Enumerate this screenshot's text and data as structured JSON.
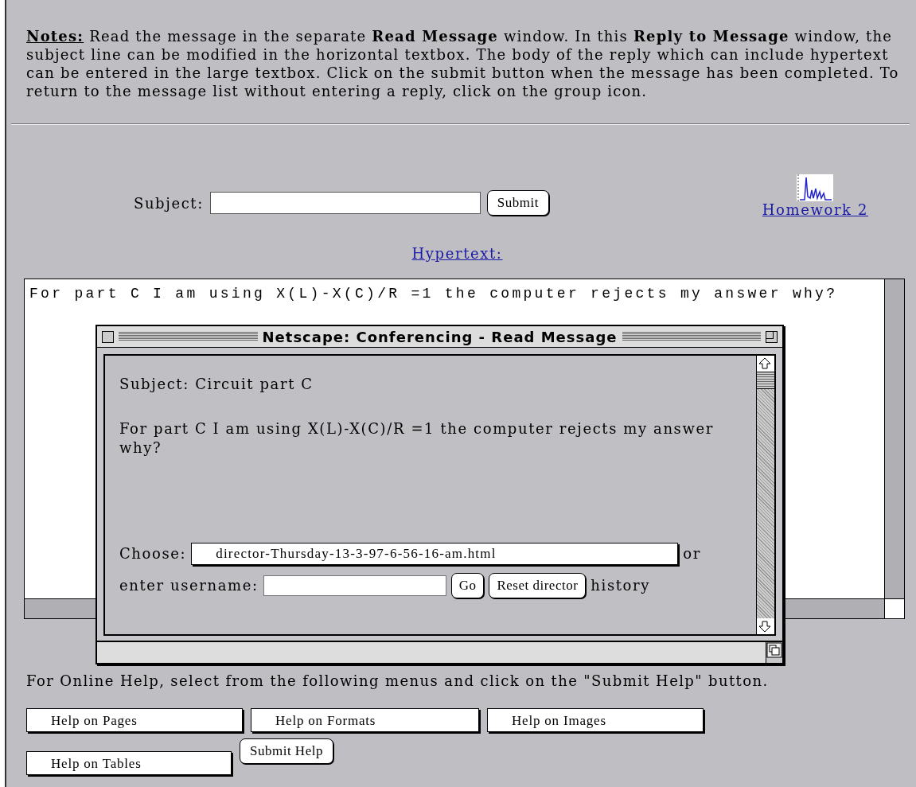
{
  "notes": {
    "label": "Notes:",
    "text": "Read the message in the separate **Read Message** window. In this **Reply to Message** window, the subject line can be modified in the horizontal textbox. The body of the reply which can include hypertext can be entered in the large textbox. Click on the submit button when the message has been completed. To return to the message list without entering a reply, click on the group icon."
  },
  "reply": {
    "subject_label": "Subject:",
    "submit": "Submit",
    "group_link": "Homework 2",
    "hypertext_link": "Hypertext:",
    "body": "For part C I am using X(L)-X(C)/R =1 the computer rejects my answer why?"
  },
  "read_window": {
    "title": "Netscape: Conferencing - Read Message",
    "subject": "Subject: Circuit part C",
    "message": "For part C I am using X(L)-X(C)/R =1 the computer rejects my answer why?",
    "choose_label": "Choose:",
    "choose_value": "director-Thursday-13-3-97-6-56-16-am.html",
    "or": "or",
    "username_label": "enter username:",
    "go": "Go",
    "reset": "Reset director",
    "history": "history"
  },
  "help": {
    "text": "For Online Help, select from the following menus and click on the \"Submit Help\" button.",
    "menus": [
      "Help on Pages",
      "Help on Formats",
      "Help on Images",
      "Help on Tables"
    ],
    "submit": "Submit Help"
  }
}
